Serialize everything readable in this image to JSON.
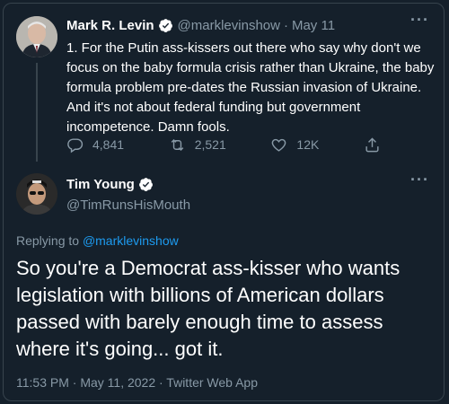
{
  "tweet1": {
    "display_name": "Mark R. Levin",
    "handle": "@marklevinshow",
    "separator": "·",
    "date": "May 11",
    "text": "1. For the Putin ass-kissers out there who say why don't we focus on the baby formula crisis rather than Ukraine, the baby formula problem pre-dates the Russian invasion of Ukraine. And it's not about federal funding but government incompetence. Damn fools.",
    "replies": "4,841",
    "retweets": "2,521",
    "likes": "12K",
    "more_label": "···"
  },
  "tweet2": {
    "display_name": "Tim Young",
    "handle": "@TimRunsHisMouth",
    "more_label": "···",
    "replying_prefix": "Replying to ",
    "replying_to": "@marklevinshow",
    "text": "So you're a Democrat ass-kisser who wants legislation with billions of American dollars passed with barely enough time to assess where it's going... got it.",
    "meta": "11:53 PM · May 11, 2022 · Twitter Web App"
  },
  "icons": {
    "verified": "verified-badge-icon",
    "reply": "reply-icon",
    "retweet": "retweet-icon",
    "like": "heart-icon",
    "share": "share-icon"
  },
  "colors": {
    "background": "#15202b",
    "secondary_text": "#8899a6",
    "link": "#1d9bf0",
    "verified": "#1d9bf0"
  }
}
